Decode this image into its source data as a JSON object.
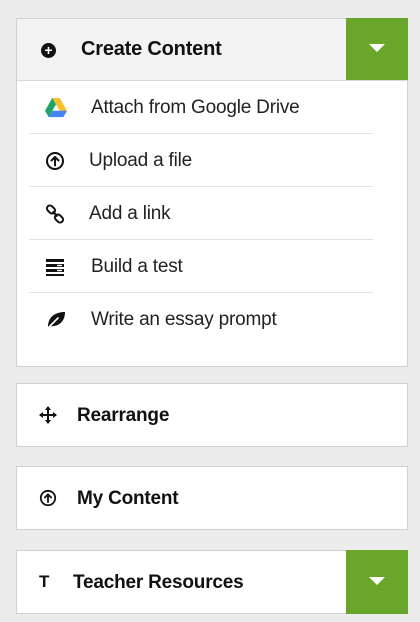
{
  "colors": {
    "accent": "#6aa629",
    "background": "#ececec",
    "panel": "#ffffff"
  },
  "create_content": {
    "title": "Create Content",
    "icon": "plus-circle-icon",
    "dropdown_icon": "caret-down-icon",
    "items": [
      {
        "label": "Attach from Google Drive",
        "icon": "google-drive-icon"
      },
      {
        "label": "Upload a file",
        "icon": "upload-circle-icon"
      },
      {
        "label": "Add a link",
        "icon": "link-icon"
      },
      {
        "label": "Build a test",
        "icon": "test-list-icon"
      },
      {
        "label": "Write an essay prompt",
        "icon": "leaf-icon"
      }
    ]
  },
  "rearrange": {
    "title": "Rearrange",
    "icon": "move-arrows-icon"
  },
  "my_content": {
    "title": "My Content",
    "icon": "upload-circle-icon"
  },
  "teacher_resources": {
    "title": "Teacher Resources",
    "icon_text": "T",
    "dropdown_icon": "caret-down-icon"
  }
}
